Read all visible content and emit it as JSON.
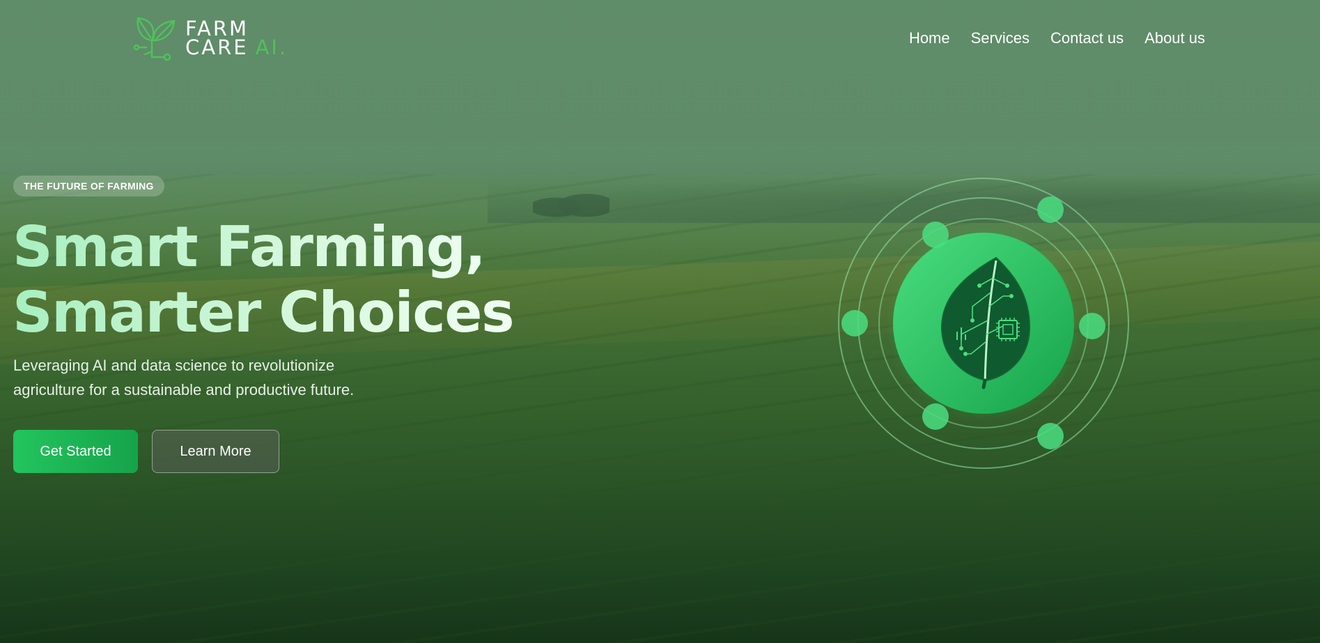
{
  "brand": {
    "line1": "FARM",
    "line2": "CARE",
    "suffix": "AI.",
    "accent_color": "#4fc15c"
  },
  "nav": {
    "items": [
      {
        "label": "Home"
      },
      {
        "label": "Services"
      },
      {
        "label": "Contact us"
      },
      {
        "label": "About us"
      }
    ]
  },
  "hero": {
    "badge": "THE FUTURE OF FARMING",
    "headline_line1": "Smart Farming,",
    "headline_line2": "Smarter Choices",
    "subtext": "Leveraging AI and data science to revolutionize agriculture for a sustainable and productive future.",
    "primary_cta": "Get Started",
    "secondary_cta": "Learn More"
  },
  "illustration": {
    "icon": "leaf-circuit-icon",
    "primary_color": "#22c55e"
  }
}
